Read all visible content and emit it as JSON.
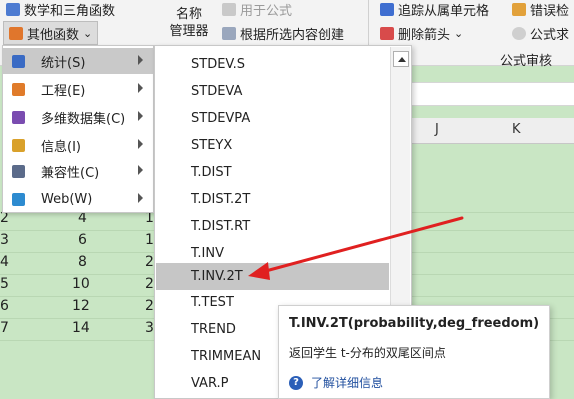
{
  "ribbon": {
    "math_trig": "数学和三角函数",
    "other_functions": "其他函数",
    "name_manager_line1": "名称",
    "name_manager_line2": "管理器",
    "use_in_formula": "用于公式",
    "create_from_selection": "根据所选内容创建",
    "trace_dependents": "追踪从属单元格",
    "error_check": "错误检",
    "remove_arrows": "删除箭头",
    "show_formulas": "公式求",
    "formula_auditing": "公式审核",
    "chevron": "⌄"
  },
  "grid": {
    "columns": [
      "J",
      "K"
    ],
    "rows": [
      {
        "a": "2",
        "b": "4",
        "c": "1"
      },
      {
        "a": "3",
        "b": "6",
        "c": "1"
      },
      {
        "a": "4",
        "b": "8",
        "c": "2"
      },
      {
        "a": "5",
        "b": "10",
        "c": "2"
      },
      {
        "a": "6",
        "b": "12",
        "c": "2"
      },
      {
        "a": "7",
        "b": "14",
        "c": "3"
      }
    ]
  },
  "menu": {
    "items": [
      {
        "label": "统计(S)",
        "icon": "statistics-icon",
        "color": "#3a6bc4"
      },
      {
        "label": "工程(E)",
        "icon": "engineering-icon",
        "color": "#e07b2a"
      },
      {
        "label": "多维数据集(C)",
        "icon": "cube-icon",
        "color": "#7a4cb0"
      },
      {
        "label": "信息(I)",
        "icon": "info-icon",
        "color": "#d9a12b"
      },
      {
        "label": "兼容性(C)",
        "icon": "compatibility-icon",
        "color": "#5b6b8a"
      },
      {
        "label": "Web(W)",
        "icon": "web-icon",
        "color": "#2d8bd0"
      }
    ]
  },
  "functions": [
    "STDEV.S",
    "STDEVA",
    "STDEVPA",
    "STEYX",
    "T.DIST",
    "T.DIST.2T",
    "T.DIST.RT",
    "T.INV",
    "T.INV.2T",
    "T.TEST",
    "TREND",
    "TRIMMEAN",
    "VAR.P"
  ],
  "tooltip": {
    "signature": "T.INV.2T(probability,deg_freedom)",
    "description": "返回学生 t-分布的双尾区间点",
    "help_link": "了解详细信息",
    "help_icon_glyph": "?"
  },
  "colors": {
    "accent_arrow": "#e02020",
    "grid_bg": "#c9e6c4",
    "highlight": "#c6c6c6"
  }
}
